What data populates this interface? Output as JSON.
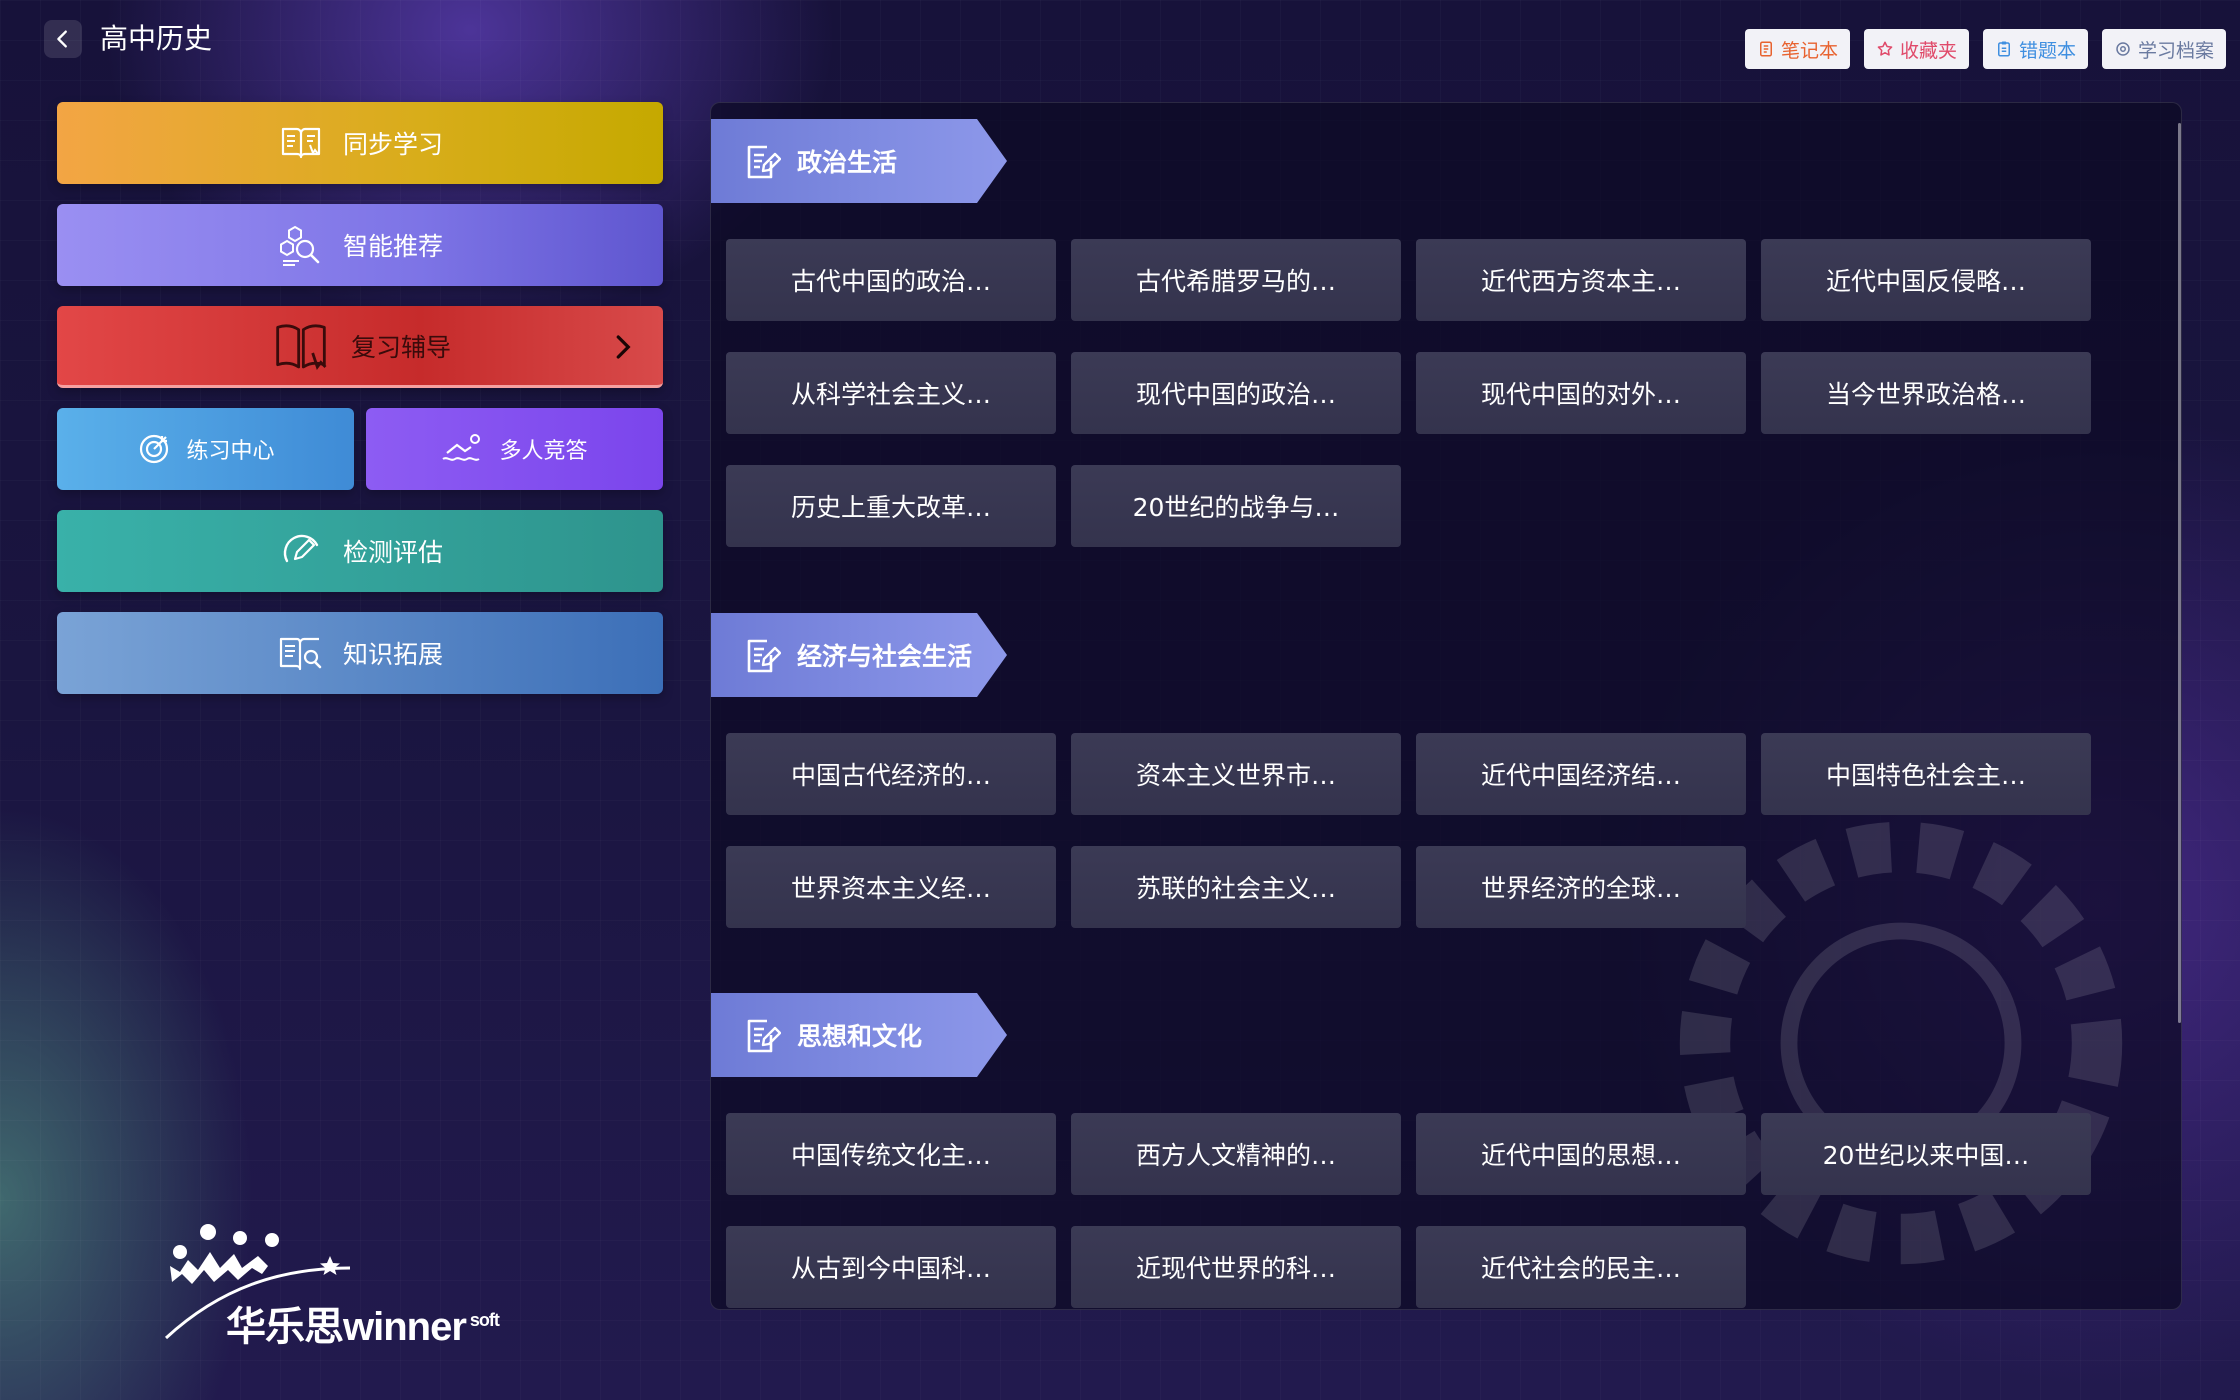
{
  "header": {
    "title": "高中历史"
  },
  "tools": [
    {
      "label": "笔记本",
      "color": "#e8622f"
    },
    {
      "label": "收藏夹",
      "color": "#e04a6a"
    },
    {
      "label": "错题本",
      "color": "#3f8fe0"
    },
    {
      "label": "学习档案",
      "color": "#6a7aa0"
    }
  ],
  "menu": {
    "sync": "同步学习",
    "recommend": "智能推荐",
    "review": "复习辅导",
    "practice": "练习中心",
    "multi": "多人竞答",
    "test": "检测评估",
    "knowledge": "知识拓展"
  },
  "logo": {
    "name": "华乐思",
    "brand": "winner",
    "soft": "soft"
  },
  "sections": [
    {
      "title": "政治生活",
      "items": [
        "古代中国的政治…",
        "古代希腊罗马的…",
        "近代西方资本主…",
        "近代中国反侵略…",
        "从科学社会主义…",
        "现代中国的政治…",
        "现代中国的对外…",
        "当今世界政治格…",
        "历史上重大改革…",
        "20世纪的战争与…"
      ]
    },
    {
      "title": "经济与社会生活",
      "items": [
        "中国古代经济的…",
        "资本主义世界市…",
        "近代中国经济结…",
        "中国特色社会主…",
        "世界资本主义经…",
        "苏联的社会主义…",
        "世界经济的全球…"
      ]
    },
    {
      "title": "思想和文化",
      "items": [
        "中国传统文化主…",
        "西方人文精神的…",
        "近代中国的思想…",
        "20世纪以来中国…",
        "从古到今中国科…",
        "近现代世界的科…",
        "近代社会的民主…"
      ]
    }
  ]
}
